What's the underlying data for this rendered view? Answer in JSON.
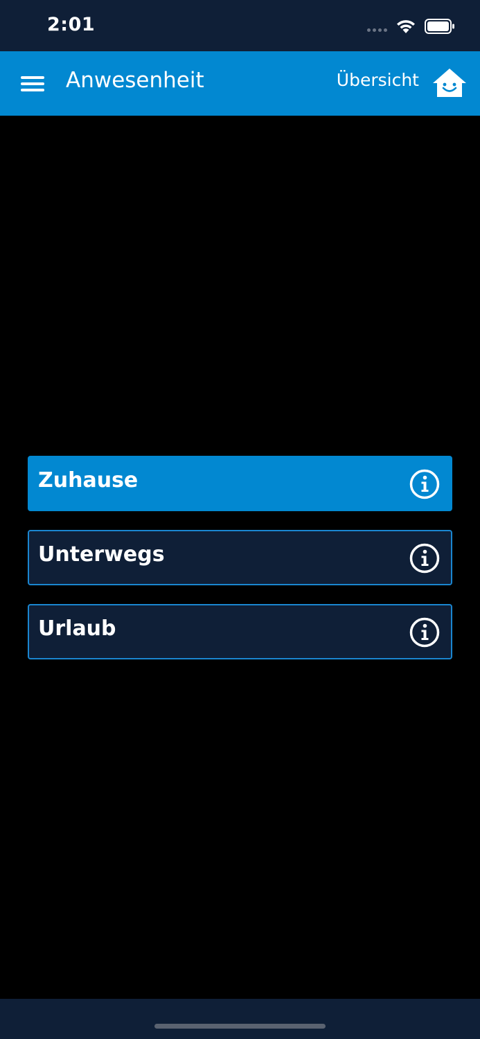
{
  "status_bar": {
    "time": "2:01",
    "icons": [
      "signal-dots-icon",
      "wifi-icon",
      "battery-icon"
    ]
  },
  "app_bar": {
    "menu_icon": "hamburger-menu-icon",
    "title": "Anwesenheit",
    "overview_label": "Übersicht",
    "home_icon": "smiling-house-icon",
    "background_color": "#0288d1"
  },
  "presence_options": [
    {
      "label": "Zuhause",
      "selected": true,
      "icon": "info-icon"
    },
    {
      "label": "Unterwegs",
      "selected": false,
      "icon": "info-icon"
    },
    {
      "label": "Urlaub",
      "selected": false,
      "icon": "info-icon"
    }
  ],
  "colors": {
    "accent": "#0288d1",
    "dark_navy": "#0f1f37",
    "background": "#000000",
    "text": "#ffffff"
  }
}
